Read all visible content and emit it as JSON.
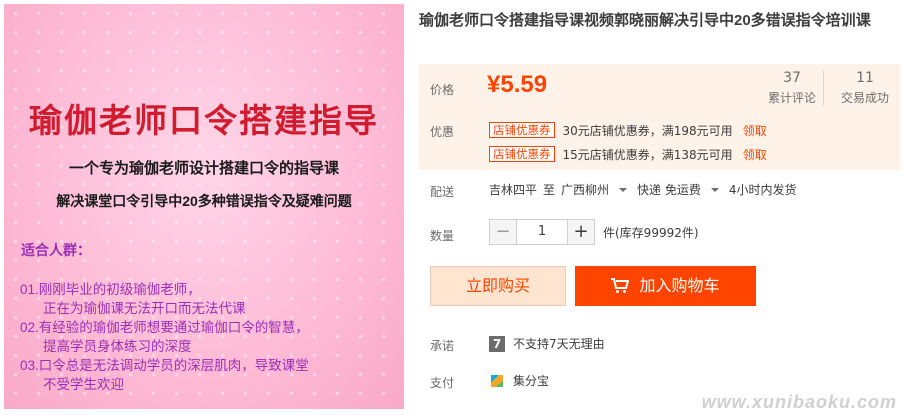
{
  "image": {
    "title": "瑜伽老师口令搭建指导",
    "subtitle1": "一个专为瑜伽老师设计搭建口令的指导课",
    "subtitle2": "解决课堂口令引导中20多种错误指令及疑难问题",
    "audience_heading": "适合人群：",
    "items": [
      "01.刚刚毕业的初级瑜伽老师，",
      "正在为瑜伽课无法开口而无法代课",
      "02.有经验的瑜伽老师想要通过瑜伽口令的智慧，",
      "提高学员身体练习的深度",
      "03.口令总是无法调动学员的深层肌肉，导致课堂",
      "不受学生欢迎"
    ]
  },
  "product": {
    "title": "瑜伽老师口令搭建指导课视频郭晓丽解决引导中20多错误指令培训课"
  },
  "price": {
    "label": "价格",
    "value": "¥5.59",
    "reviews_count": "37",
    "reviews_label": "累计评论",
    "sales_count": "11",
    "sales_label": "交易成功"
  },
  "promo": {
    "label": "优惠",
    "coupons": [
      {
        "tag": "店铺优惠券",
        "desc": "30元店铺优惠券，满198元可用",
        "claim": "领取"
      },
      {
        "tag": "店铺优惠券",
        "desc": "15元店铺优惠券，满138元可用",
        "claim": "领取"
      }
    ]
  },
  "shipping": {
    "label": "配送",
    "from": "吉林四平",
    "to_label": "至",
    "destination": "广西柳州",
    "method": "快递 免运费",
    "time": "4小时内发货"
  },
  "quantity": {
    "label": "数量",
    "minus": "−",
    "value": "1",
    "plus": "+",
    "stock": "件(库存99992件)"
  },
  "actions": {
    "buy_now": "立即购买",
    "add_cart": "加入购物车"
  },
  "promise": {
    "label": "承诺",
    "icon_text": "7",
    "text": "不支持7天无理由"
  },
  "payment": {
    "label": "支付",
    "text": "集分宝"
  },
  "watermark": "www.xunibaoku.com",
  "colors": {
    "accent": "#ff4400",
    "price_bg": "#fff2e8",
    "image_text_purple": "#9a2fb5",
    "image_title_red": "#d01c2e"
  }
}
